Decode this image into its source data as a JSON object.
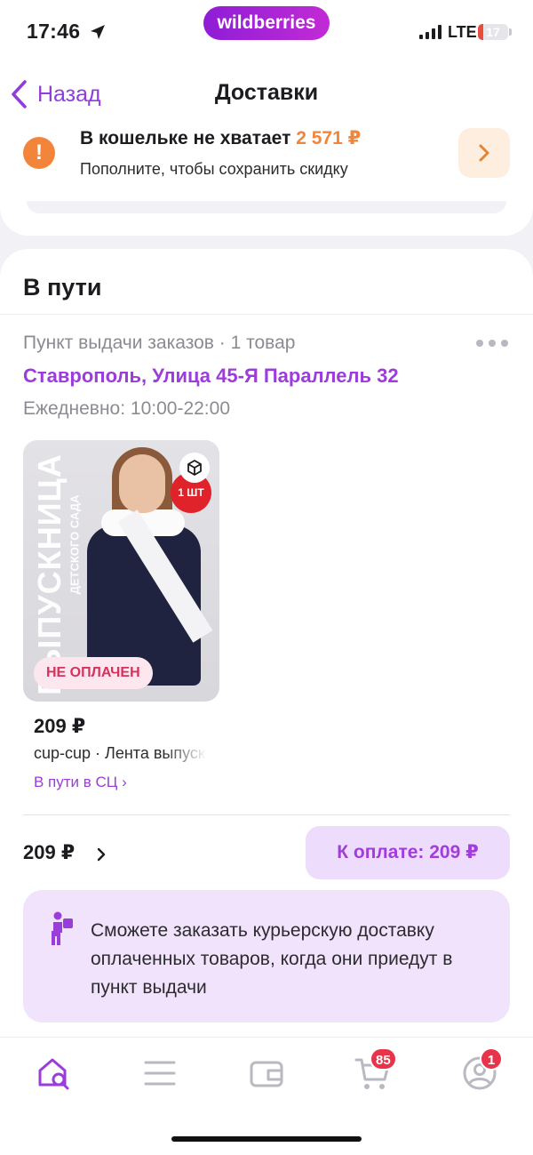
{
  "status_bar": {
    "time": "17:46",
    "network": "LTE",
    "battery_level": "17",
    "battery_fraction": 0.17
  },
  "brand": {
    "logo_text": "wildberries"
  },
  "header": {
    "back_label": "Назад",
    "title": "Доставки"
  },
  "wallet_alert": {
    "title_prefix": "В кошельке не хватает ",
    "amount": "2 571 ₽",
    "subtitle": "Пополните, чтобы сохранить скидку",
    "icon": "exclamation-icon"
  },
  "section": {
    "title": "В пути",
    "pickup_meta": "Пункт выдачи заказов · 1 товар",
    "address": "Ставрополь, Улица 45-Я Параллель 32",
    "hours": "Ежедневно: 10:00-22:00"
  },
  "product": {
    "image_text": "ВЫПУСКНИЦА",
    "image_subtext": "ДЕТСКОГО САДА",
    "sticker": "1 ШТ",
    "badge": "НЕ ОПЛАЧЕН",
    "price": "209 ₽",
    "name": "cup-cup · Лента выпускница",
    "status": "В пути в СЦ ›"
  },
  "totals": {
    "amount": "209 ₽",
    "pay_button": "К оплате: 209 ₽"
  },
  "courier_banner": {
    "text": "Сможете заказать курьерскую доставку оплаченных товаров, когда они приедут в пункт выдачи",
    "icon": "courier-icon"
  },
  "tabbar": {
    "items": [
      {
        "name": "home",
        "icon": "home-search-icon",
        "active": true
      },
      {
        "name": "catalog",
        "icon": "menu-icon"
      },
      {
        "name": "wallet",
        "icon": "wallet-icon"
      },
      {
        "name": "cart",
        "icon": "cart-icon",
        "badge": "85"
      },
      {
        "name": "profile",
        "icon": "profile-icon",
        "badge": "1"
      }
    ]
  },
  "colors": {
    "accent": "#9b3ddb",
    "warning": "#f2853a",
    "badge": "#e8344a"
  }
}
